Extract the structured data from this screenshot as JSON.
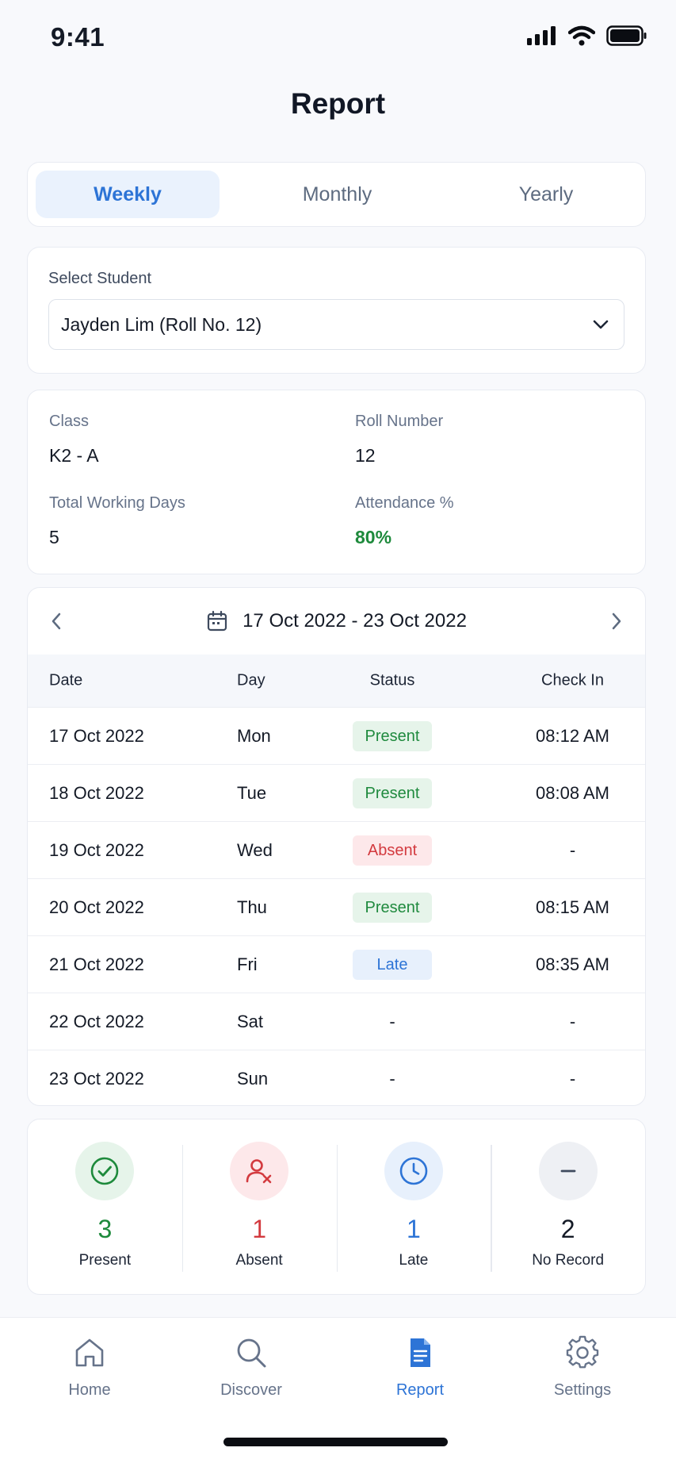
{
  "status_bar": {
    "time": "9:41"
  },
  "page_title": "Report",
  "period_tabs": [
    {
      "label": "Weekly",
      "active": true
    },
    {
      "label": "Monthly",
      "active": false
    },
    {
      "label": "Yearly",
      "active": false
    }
  ],
  "student_select": {
    "label": "Select Student",
    "value": "Jayden Lim (Roll No. 12)"
  },
  "info": {
    "class_label": "Class",
    "class_value": "K2 - A",
    "roll_label": "Roll Number",
    "roll_value": "12",
    "working_days_label": "Total Working Days",
    "working_days_value": "5",
    "attendance_label": "Attendance %",
    "attendance_value": "80%"
  },
  "week": {
    "range": "17 Oct 2022 - 23 Oct 2022",
    "columns": [
      "Date",
      "Day",
      "Status",
      "Check In"
    ],
    "rows": [
      {
        "date": "17 Oct 2022",
        "day": "Mon",
        "status": "Present",
        "check_in": "08:12 AM"
      },
      {
        "date": "18 Oct 2022",
        "day": "Tue",
        "status": "Present",
        "check_in": "08:08 AM"
      },
      {
        "date": "19 Oct 2022",
        "day": "Wed",
        "status": "Absent",
        "check_in": "-"
      },
      {
        "date": "20 Oct 2022",
        "day": "Thu",
        "status": "Present",
        "check_in": "08:15 AM"
      },
      {
        "date": "21 Oct 2022",
        "day": "Fri",
        "status": "Late",
        "check_in": "08:35 AM"
      },
      {
        "date": "22 Oct 2022",
        "day": "Sat",
        "status": "-",
        "check_in": "-"
      },
      {
        "date": "23 Oct 2022",
        "day": "Sun",
        "status": "-",
        "check_in": "-"
      }
    ]
  },
  "summary": [
    {
      "count": "3",
      "label": "Present",
      "icon": "check-circle-icon",
      "color": "#1e8a3c",
      "bg": "#e6f4ea"
    },
    {
      "count": "1",
      "label": "Absent",
      "icon": "user-x-icon",
      "color": "#d33a3f",
      "bg": "#fde8ea"
    },
    {
      "count": "1",
      "label": "Late",
      "icon": "clock-icon",
      "color": "#2d74d6",
      "bg": "#e7f0fc"
    },
    {
      "count": "2",
      "label": "No Record",
      "icon": "minus-icon",
      "color": "#141a26",
      "bg": "#eef0f4"
    }
  ],
  "bottom_nav": [
    {
      "label": "Home",
      "icon": "home-icon",
      "active": false
    },
    {
      "label": "Discover",
      "icon": "search-icon",
      "active": false
    },
    {
      "label": "Report",
      "icon": "report-document-icon",
      "active": true
    },
    {
      "label": "Settings",
      "icon": "gear-icon",
      "active": false
    }
  ],
  "colors": {
    "accent": "#2d74d6",
    "present": "#1e8a3c",
    "absent": "#d33a3f"
  }
}
